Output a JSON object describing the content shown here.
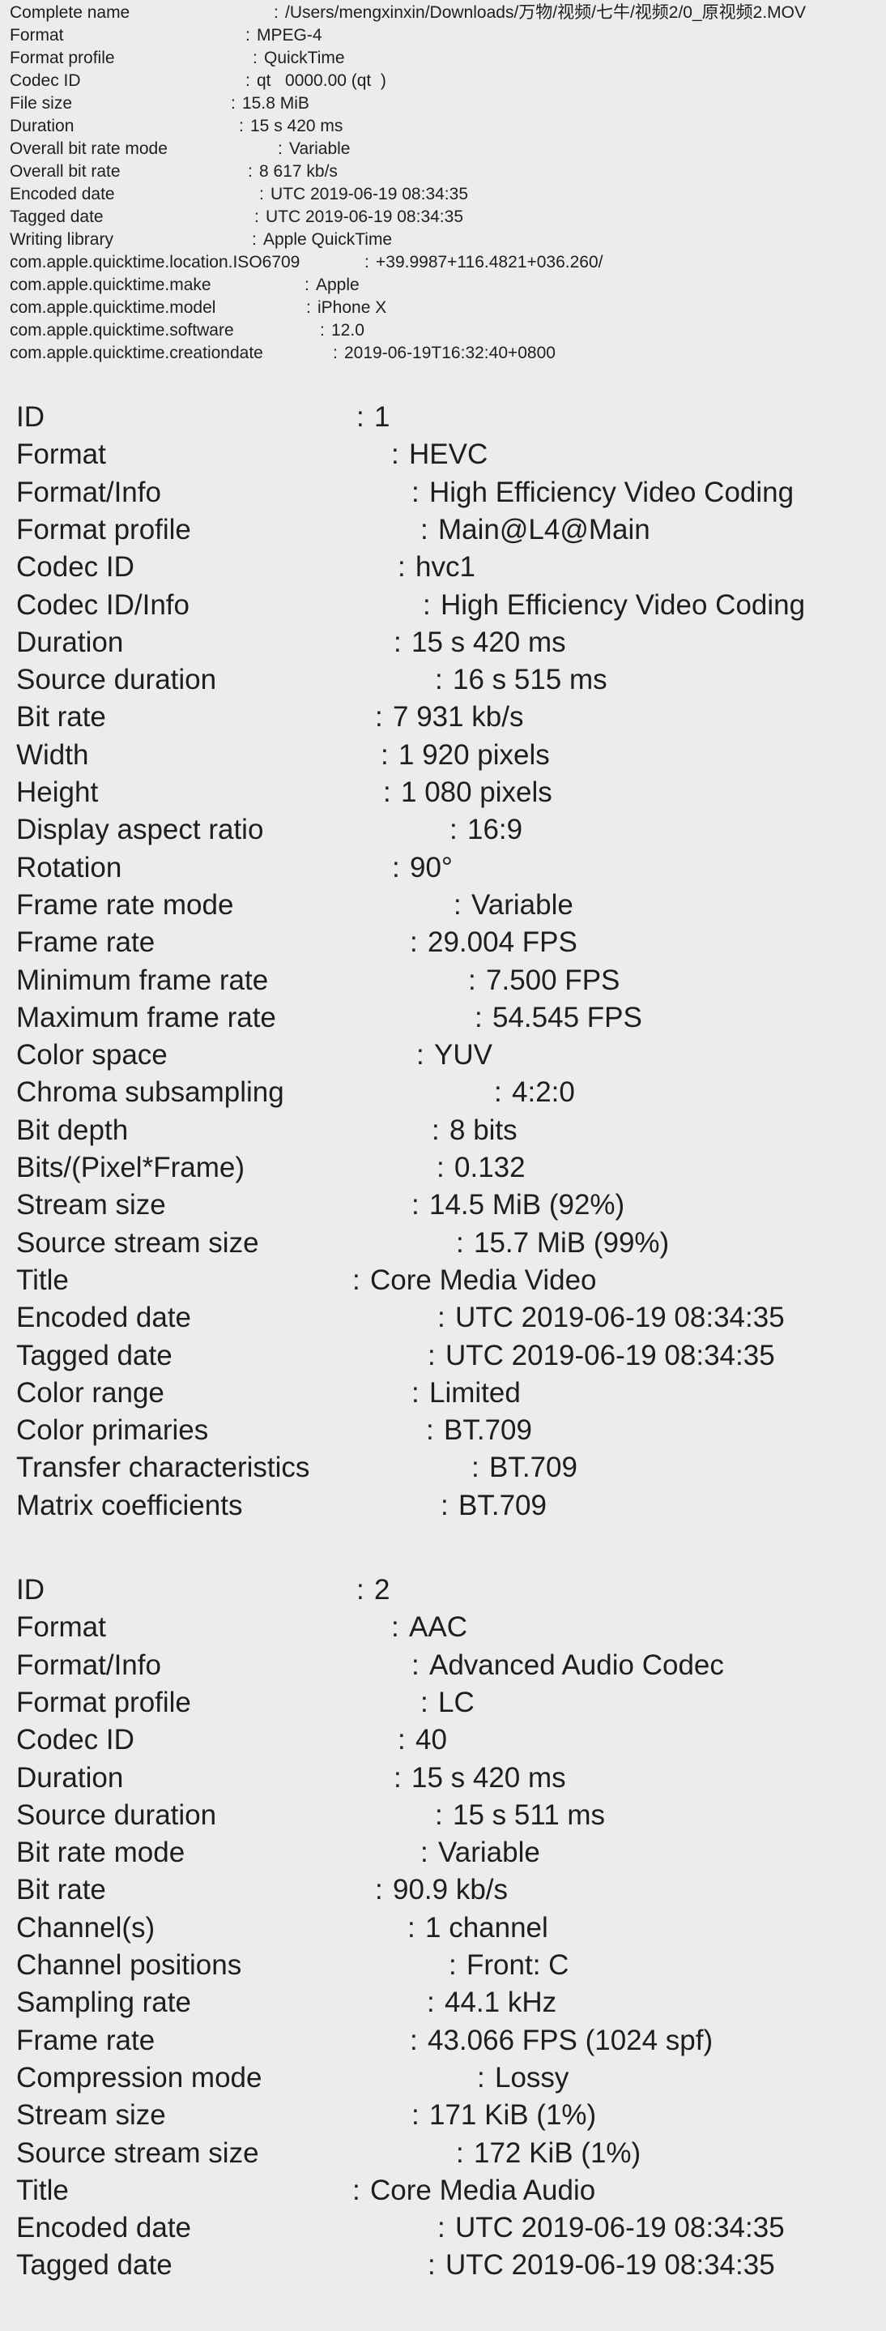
{
  "general": [
    {
      "label": "Complete name",
      "value": "/Users/mengxinxin/Downloads/万物/视频/七牛/视频2/0_原视频2.MOV"
    },
    {
      "label": "Format",
      "value": "MPEG-4"
    },
    {
      "label": "Format profile",
      "value": "QuickTime"
    },
    {
      "label": "Codec ID",
      "value": "qt   0000.00 (qt  )"
    },
    {
      "label": "File size",
      "value": "15.8 MiB"
    },
    {
      "label": "Duration",
      "value": "15 s 420 ms"
    },
    {
      "label": "Overall bit rate mode",
      "value": "Variable"
    },
    {
      "label": "Overall bit rate",
      "value": "8 617 kb/s"
    },
    {
      "label": "Encoded date",
      "value": "UTC 2019-06-19 08:34:35"
    },
    {
      "label": "Tagged date",
      "value": "UTC 2019-06-19 08:34:35"
    },
    {
      "label": "Writing library",
      "value": "Apple QuickTime"
    },
    {
      "label": "com.apple.quicktime.location.ISO6709",
      "value": "+39.9987+116.4821+036.260/"
    },
    {
      "label": "com.apple.quicktime.make",
      "value": "Apple"
    },
    {
      "label": "com.apple.quicktime.model",
      "value": "iPhone X"
    },
    {
      "label": "com.apple.quicktime.software",
      "value": "12.0"
    },
    {
      "label": "com.apple.quicktime.creationdate",
      "value": "2019-06-19T16:32:40+0800"
    }
  ],
  "video": [
    {
      "label": "ID",
      "value": "1"
    },
    {
      "label": "Format",
      "value": "HEVC"
    },
    {
      "label": "Format/Info",
      "value": "High Efficiency Video Coding"
    },
    {
      "label": "Format profile",
      "value": "Main@L4@Main"
    },
    {
      "label": "Codec ID",
      "value": "hvc1"
    },
    {
      "label": "Codec ID/Info",
      "value": "High Efficiency Video Coding"
    },
    {
      "label": "Duration",
      "value": "15 s 420 ms"
    },
    {
      "label": "Source duration",
      "value": "16 s 515 ms"
    },
    {
      "label": "Bit rate",
      "value": "7 931 kb/s"
    },
    {
      "label": "Width",
      "value": "1 920 pixels"
    },
    {
      "label": "Height",
      "value": "1 080 pixels"
    },
    {
      "label": "Display aspect ratio",
      "value": "16:9"
    },
    {
      "label": "Rotation",
      "value": "90°"
    },
    {
      "label": "Frame rate mode",
      "value": "Variable"
    },
    {
      "label": "Frame rate",
      "value": "29.004 FPS"
    },
    {
      "label": "Minimum frame rate",
      "value": "7.500 FPS"
    },
    {
      "label": "Maximum frame rate",
      "value": "54.545 FPS"
    },
    {
      "label": "Color space",
      "value": "YUV"
    },
    {
      "label": "Chroma subsampling",
      "value": "4:2:0"
    },
    {
      "label": "Bit depth",
      "value": "8 bits"
    },
    {
      "label": "Bits/(Pixel*Frame)",
      "value": "0.132"
    },
    {
      "label": "Stream size",
      "value": "14.5 MiB (92%)"
    },
    {
      "label": "Source stream size",
      "value": "15.7 MiB (99%)"
    },
    {
      "label": "Title",
      "value": "Core Media Video"
    },
    {
      "label": "Encoded date",
      "value": "UTC 2019-06-19 08:34:35"
    },
    {
      "label": "Tagged date",
      "value": "UTC 2019-06-19 08:34:35"
    },
    {
      "label": "Color range",
      "value": "Limited"
    },
    {
      "label": "Color primaries",
      "value": "BT.709"
    },
    {
      "label": "Transfer characteristics",
      "value": "BT.709"
    },
    {
      "label": "Matrix coefficients",
      "value": "BT.709"
    }
  ],
  "audio": [
    {
      "label": "ID",
      "value": "2"
    },
    {
      "label": "Format",
      "value": "AAC"
    },
    {
      "label": "Format/Info",
      "value": "Advanced Audio Codec"
    },
    {
      "label": "Format profile",
      "value": "LC"
    },
    {
      "label": "Codec ID",
      "value": "40"
    },
    {
      "label": "Duration",
      "value": "15 s 420 ms"
    },
    {
      "label": "Source duration",
      "value": "15 s 511 ms"
    },
    {
      "label": "Bit rate mode",
      "value": "Variable"
    },
    {
      "label": "Bit rate",
      "value": "90.9 kb/s"
    },
    {
      "label": "Channel(s)",
      "value": "1 channel"
    },
    {
      "label": "Channel positions",
      "value": "Front: C"
    },
    {
      "label": "Sampling rate",
      "value": "44.1 kHz"
    },
    {
      "label": "Frame rate",
      "value": "43.066 FPS (1024 spf)"
    },
    {
      "label": "Compression mode",
      "value": "Lossy"
    },
    {
      "label": "Stream size",
      "value": "171 KiB (1%)"
    },
    {
      "label": "Source stream size",
      "value": "172 KiB (1%)"
    },
    {
      "label": "Title",
      "value": "Core Media Audio"
    },
    {
      "label": "Encoded date",
      "value": "UTC 2019-06-19 08:34:35"
    },
    {
      "label": "Tagged date",
      "value": "UTC 2019-06-19 08:34:35"
    }
  ]
}
